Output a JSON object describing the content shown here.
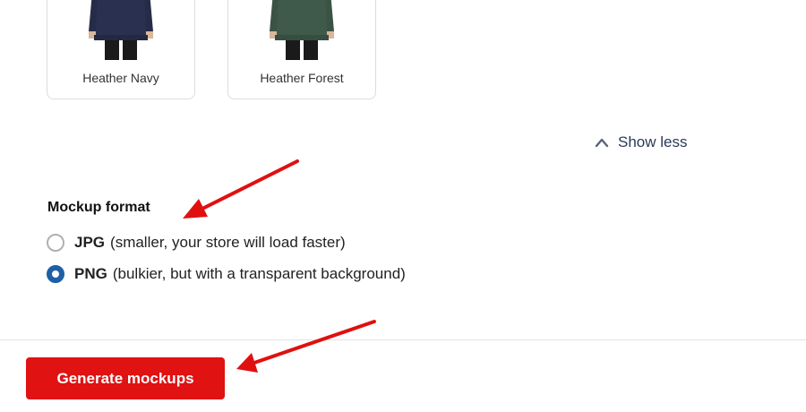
{
  "colors": {
    "accent_red": "#e01212",
    "radio_blue": "#1f5fa6",
    "annotation_arrow": "#e01010",
    "heather_navy": "#2a3150",
    "heather_forest": "#3f5a4a"
  },
  "swatches": [
    {
      "label": "Heather Navy",
      "icon": "hoodie-image"
    },
    {
      "label": "Heather Forest",
      "icon": "hoodie-image"
    }
  ],
  "show_less": {
    "label": "Show less",
    "icon": "chevron-up-icon"
  },
  "mockup_format": {
    "title": "Mockup format",
    "options": [
      {
        "name": "JPG",
        "description": "(smaller, your store will load faster)",
        "selected": false
      },
      {
        "name": "PNG",
        "description": "(bulkier, but with a transparent background)",
        "selected": true
      }
    ]
  },
  "footer": {
    "generate_label": "Generate mockups"
  }
}
